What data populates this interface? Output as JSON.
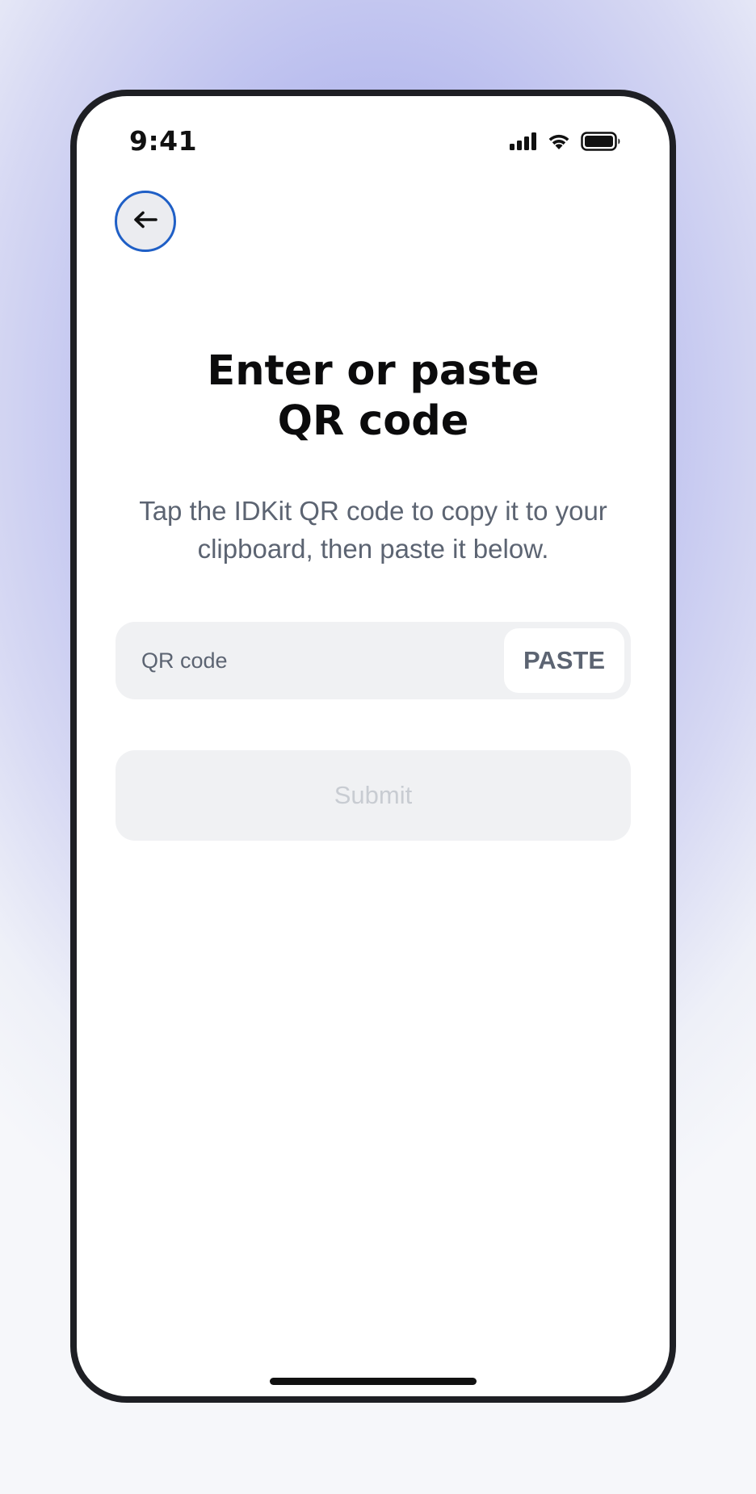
{
  "status_bar": {
    "time": "9:41",
    "icons": [
      "signal-icon",
      "wifi-icon",
      "battery-icon"
    ]
  },
  "header": {
    "back_icon": "arrow-left-icon"
  },
  "main": {
    "title": "Enter or paste\nQR code",
    "subtitle": "Tap the IDKit QR code to copy it to your clipboard, then paste it below.",
    "qr_input": {
      "placeholder": "QR code",
      "value": ""
    },
    "paste_label": "PASTE",
    "submit_label": "Submit"
  },
  "colors": {
    "accent_focus_ring": "#1f5fc6",
    "title_text": "#0b0b0c",
    "secondary_text": "#5c6472",
    "disabled_text": "#c8ccd2",
    "field_background": "#f0f1f3",
    "background_gradient": "#a9aeea"
  }
}
